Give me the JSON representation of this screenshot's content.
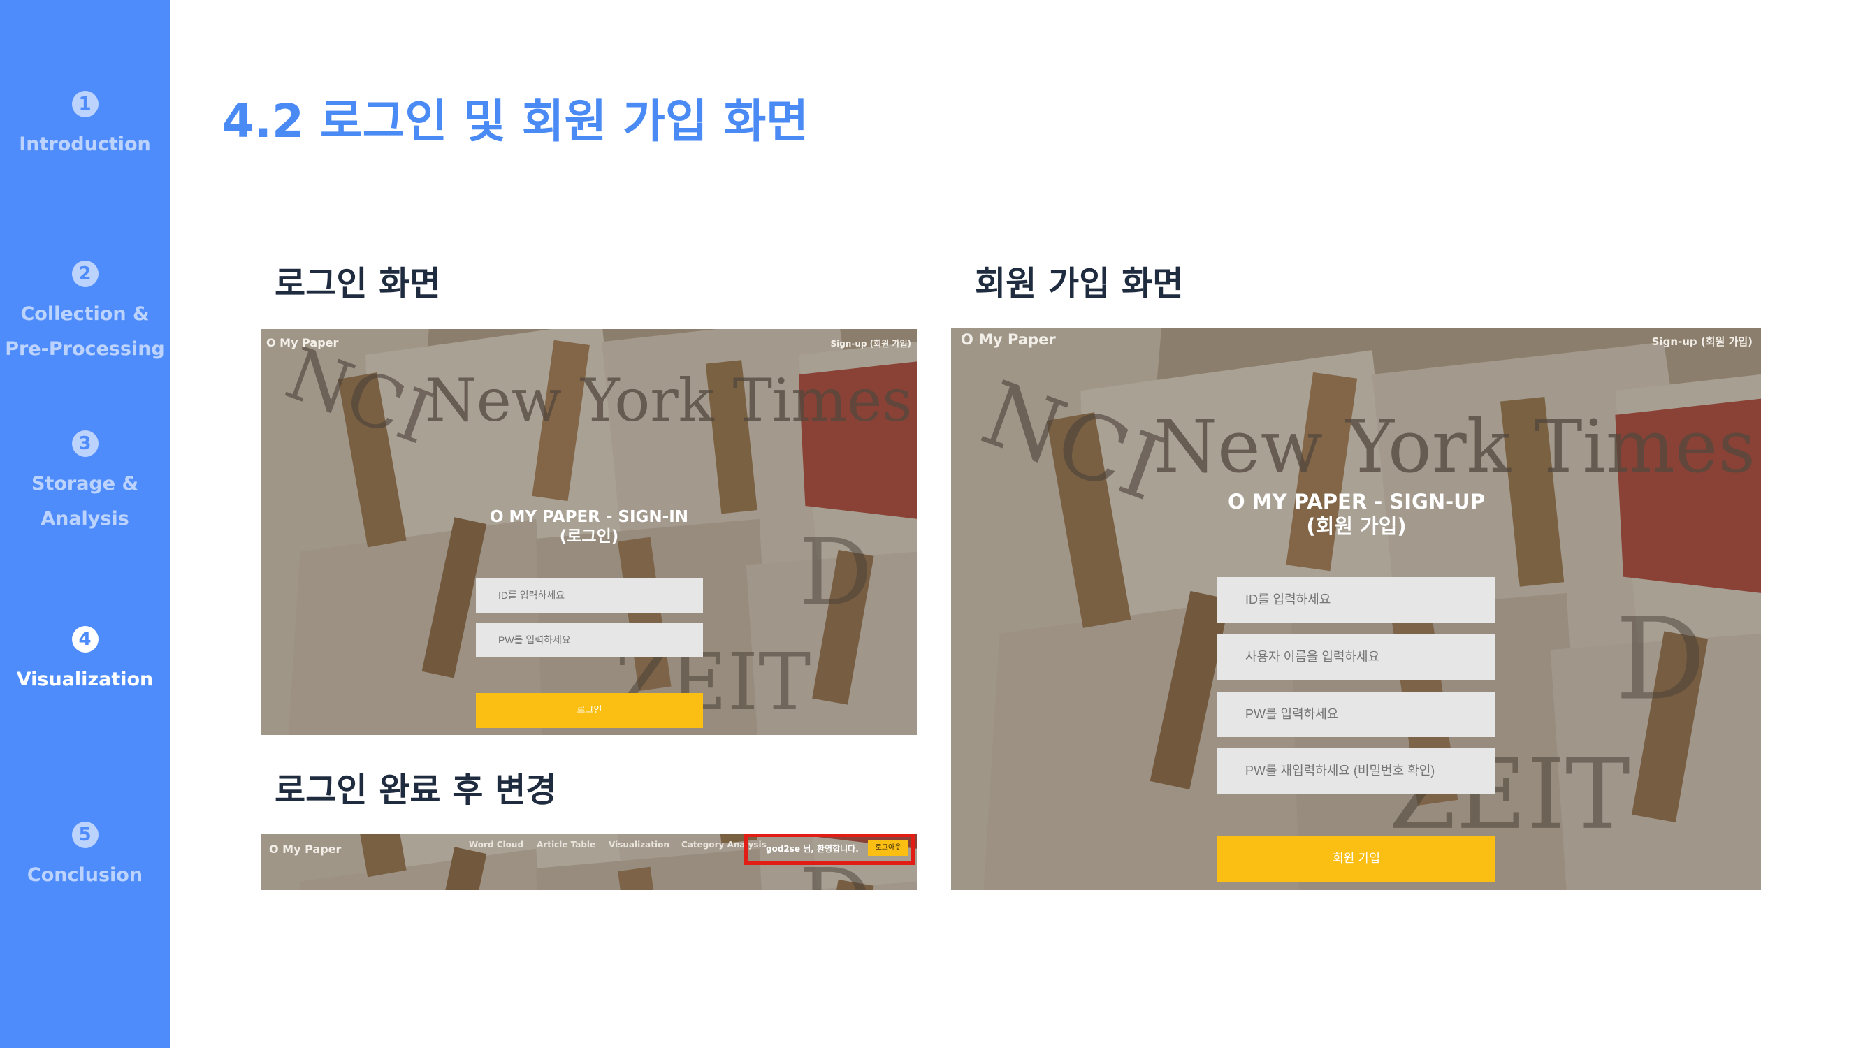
{
  "sidebar": {
    "items": [
      {
        "num": "1",
        "label_lines": [
          "Introduction"
        ]
      },
      {
        "num": "2",
        "label_lines": [
          "Collection &",
          "Pre-Processing"
        ]
      },
      {
        "num": "3",
        "label_lines": [
          "Storage &",
          "Analysis"
        ]
      },
      {
        "num": "4",
        "label_lines": [
          "Visualization"
        ],
        "active": true
      },
      {
        "num": "5",
        "label_lines": [
          "Conclusion"
        ]
      }
    ]
  },
  "slide": {
    "title": "4.2 로그인 및 회원 가입 화면"
  },
  "sections": {
    "login": "로그인 화면",
    "signup": "회원 가입 화면",
    "after_login": "로그인 완료 후 변경"
  },
  "login_screen": {
    "brand": "O My Paper",
    "signup_link": "Sign-up (회원 가입)",
    "title_line1": "O MY PAPER - SIGN-IN",
    "title_line2": "(로그인)",
    "id_placeholder": "ID를 입력하세요",
    "pw_placeholder": "PW를 입력하세요",
    "submit_label": "로그인"
  },
  "signup_screen": {
    "brand": "O My Paper",
    "signup_link": "Sign-up (회원 가입)",
    "title_line1": "O MY PAPER - SIGN-UP",
    "title_line2": "(회원 가입)",
    "id_placeholder": "ID를 입력하세요",
    "name_placeholder": "사용자 이름을 입력하세요",
    "pw_placeholder": "PW를 입력하세요",
    "pw_confirm_placeholder": "PW를 재입력하세요 (비밀번호 확인)",
    "submit_label": "회원 가입"
  },
  "after_login_bar": {
    "brand": "O My Paper",
    "nav": [
      "Word Cloud",
      "Article Table",
      "Visualization",
      "Category Analysis"
    ],
    "welcome": "god2se 님, 환영합니다.",
    "logout_label": "로그아웃"
  },
  "colors": {
    "sidebar": "#4f8cfb",
    "title": "#4a8af4",
    "subtitle": "#1f2b3e",
    "button": "#fbbf13",
    "highlight": "#e21d16"
  }
}
